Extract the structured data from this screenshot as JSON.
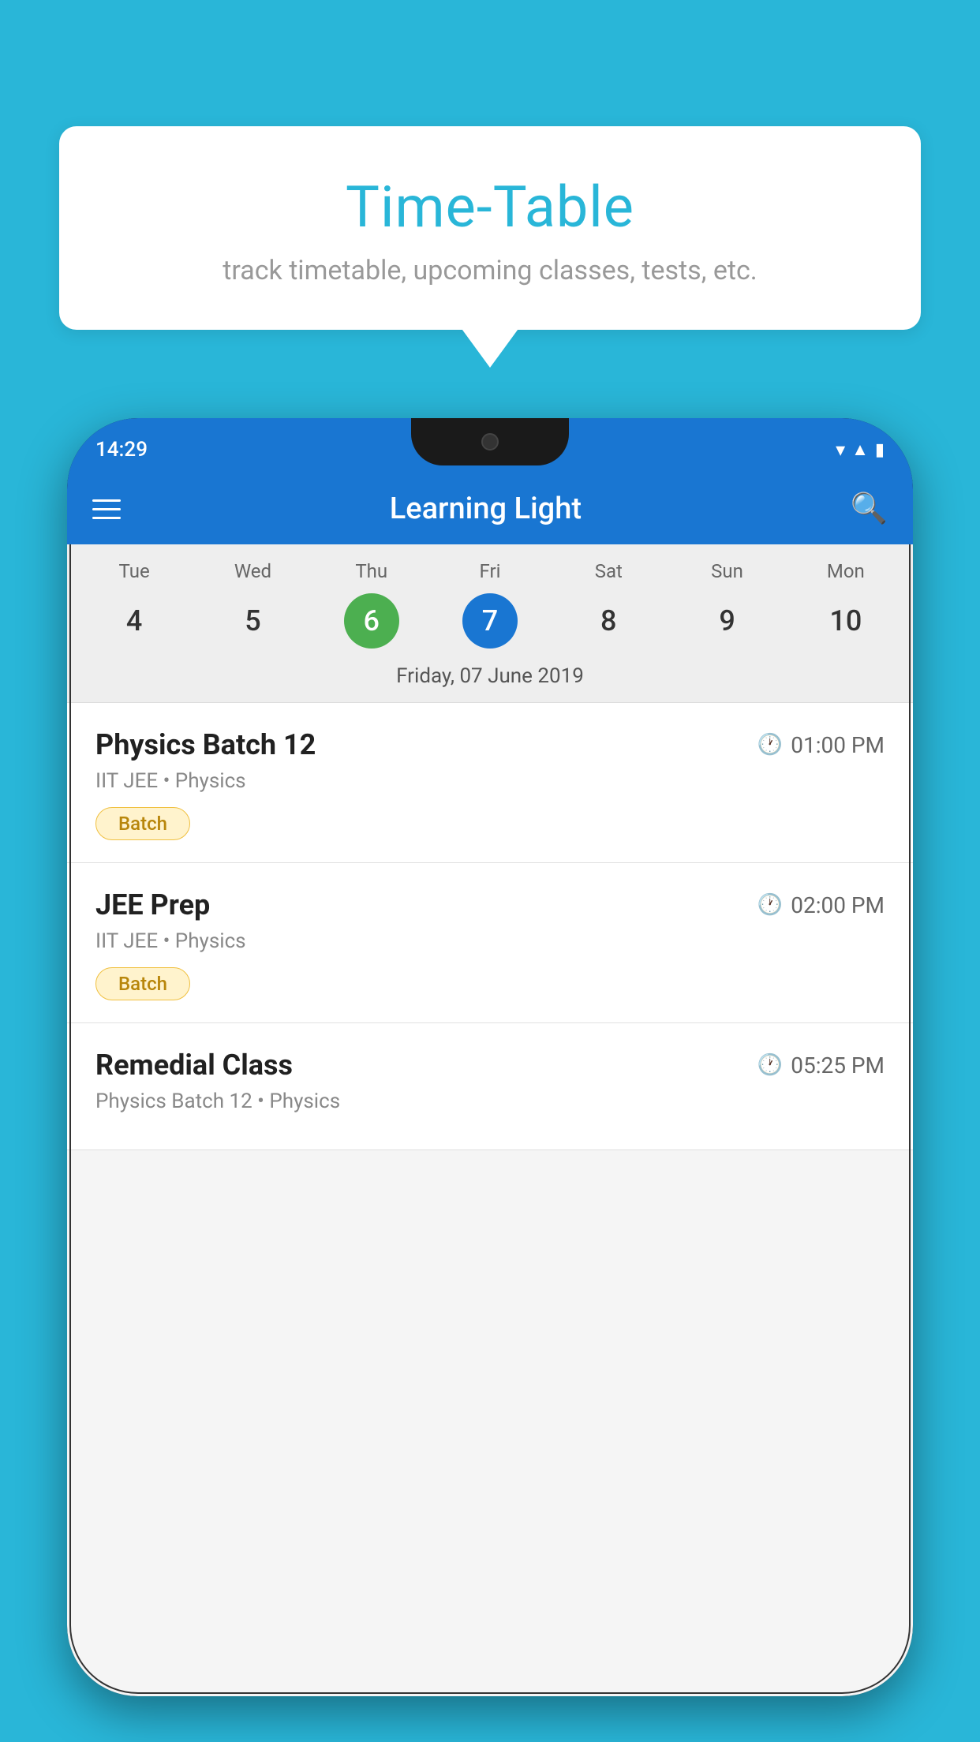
{
  "background_color": "#29B6D8",
  "bubble": {
    "title": "Time-Table",
    "subtitle": "track timetable, upcoming classes, tests, etc."
  },
  "phone": {
    "status_bar": {
      "time": "14:29"
    },
    "app_bar": {
      "title": "Learning Light"
    },
    "calendar": {
      "days": [
        {
          "name": "Tue",
          "num": "4",
          "state": "normal"
        },
        {
          "name": "Wed",
          "num": "5",
          "state": "normal"
        },
        {
          "name": "Thu",
          "num": "6",
          "state": "today"
        },
        {
          "name": "Fri",
          "num": "7",
          "state": "selected"
        },
        {
          "name": "Sat",
          "num": "8",
          "state": "normal"
        },
        {
          "name": "Sun",
          "num": "9",
          "state": "normal"
        },
        {
          "name": "Mon",
          "num": "10",
          "state": "normal"
        }
      ],
      "selected_date_label": "Friday, 07 June 2019"
    },
    "classes": [
      {
        "name": "Physics Batch 12",
        "time": "01:00 PM",
        "detail": "IIT JEE • Physics",
        "badge": "Batch"
      },
      {
        "name": "JEE Prep",
        "time": "02:00 PM",
        "detail": "IIT JEE • Physics",
        "badge": "Batch"
      },
      {
        "name": "Remedial Class",
        "time": "05:25 PM",
        "detail": "Physics Batch 12 • Physics",
        "badge": null
      }
    ]
  }
}
